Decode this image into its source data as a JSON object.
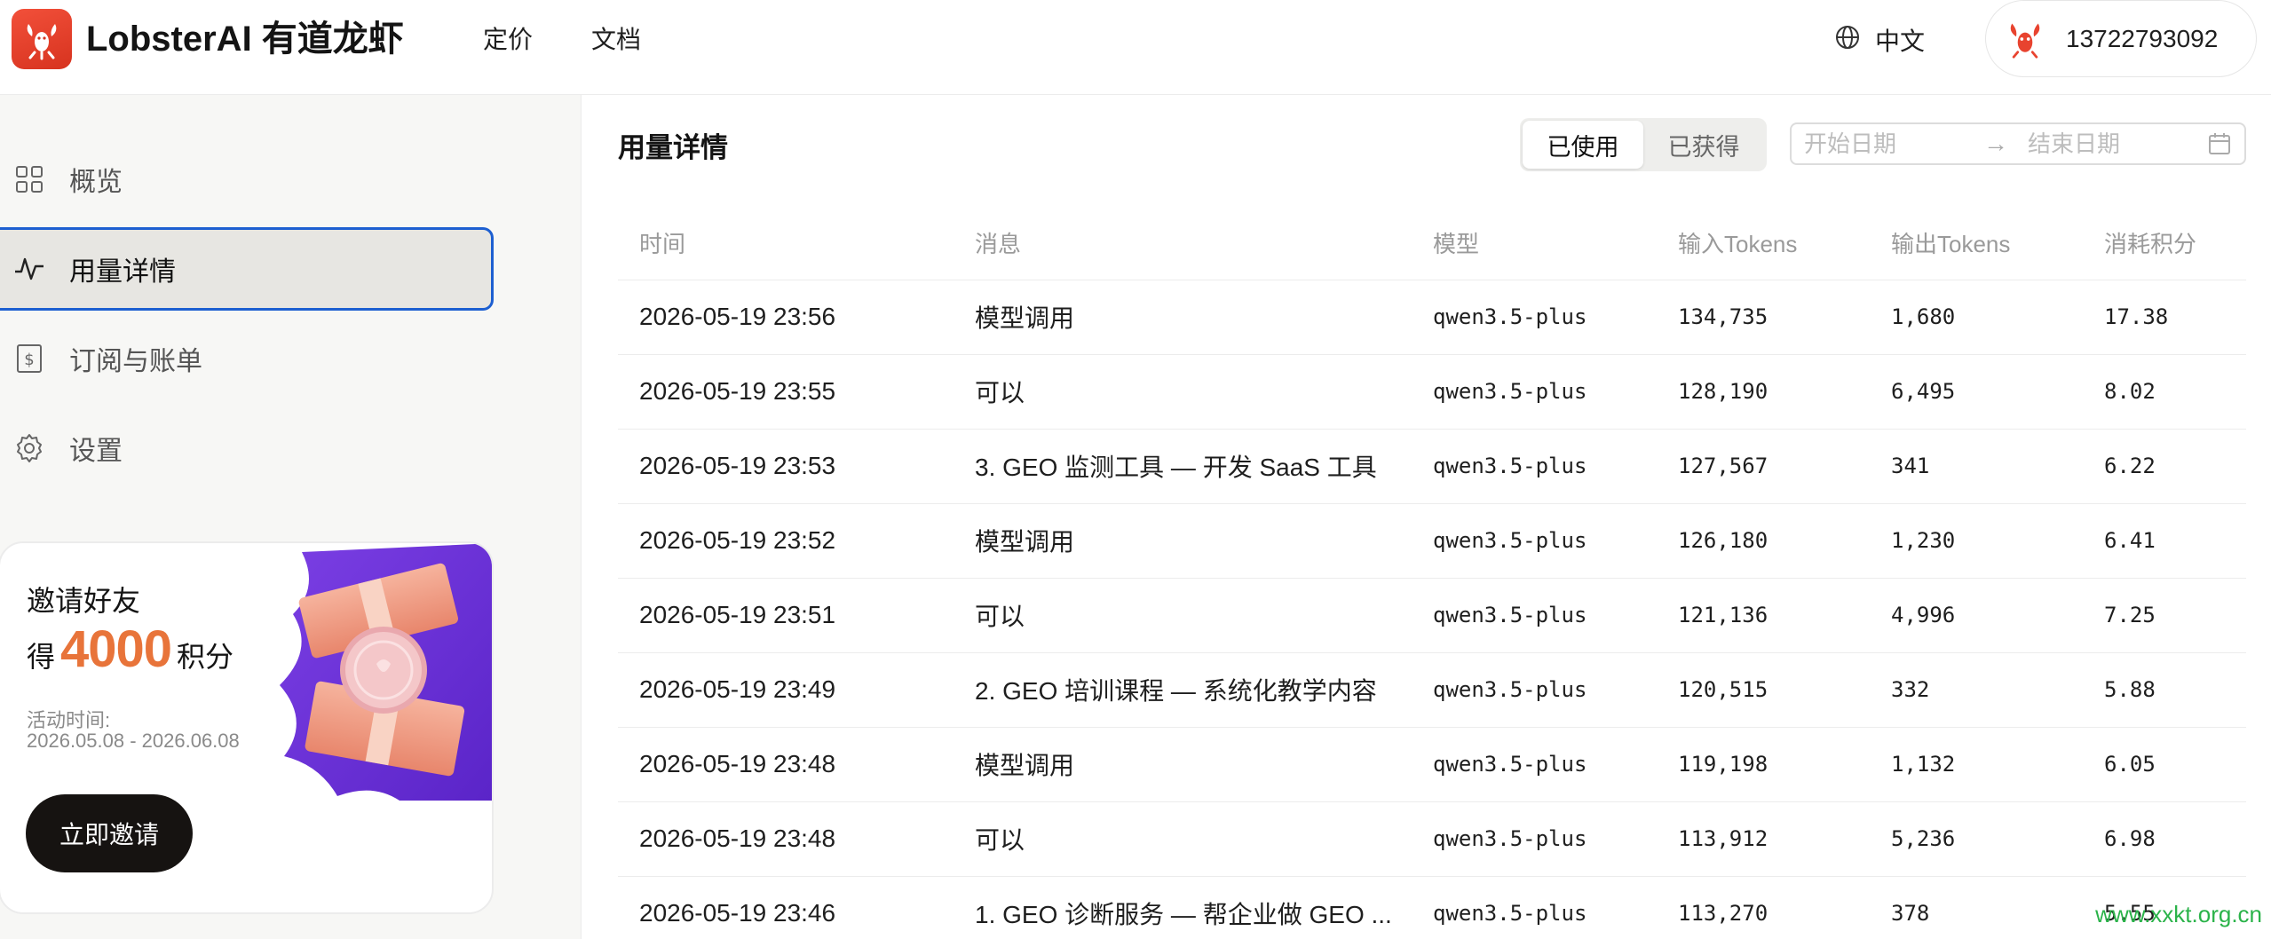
{
  "app": {
    "name": "LobsterAI 有道龙虾"
  },
  "nav": {
    "pricing": "定价",
    "docs": "文档"
  },
  "header": {
    "language": "中文",
    "user_phone": "13722793092"
  },
  "sidebar": {
    "items": [
      {
        "label": "概览",
        "icon": "grid-icon"
      },
      {
        "label": "用量详情",
        "icon": "activity-icon",
        "active": true
      },
      {
        "label": "订阅与账单",
        "icon": "billing-icon"
      },
      {
        "label": "设置",
        "icon": "gear-icon"
      }
    ]
  },
  "promo": {
    "title": "邀请好友",
    "prefix": "得",
    "points": "4000",
    "suffix": "积分",
    "period_label": "活动时间:",
    "period": "2026.05.08 - 2026.06.08",
    "button": "立即邀请"
  },
  "main": {
    "title": "用量详情",
    "tabs": [
      {
        "label": "已使用",
        "selected": true
      },
      {
        "label": "已获得",
        "selected": false
      }
    ],
    "date_range": {
      "start_placeholder": "开始日期",
      "end_placeholder": "结束日期"
    },
    "columns": [
      "时间",
      "消息",
      "模型",
      "输入Tokens",
      "输出Tokens",
      "消耗积分"
    ],
    "rows": [
      [
        "2026-05-19 23:56",
        "模型调用",
        "qwen3.5-plus",
        "134,735",
        "1,680",
        "17.38"
      ],
      [
        "2026-05-19 23:55",
        "可以",
        "qwen3.5-plus",
        "128,190",
        "6,495",
        "8.02"
      ],
      [
        "2026-05-19 23:53",
        "3. GEO 监测工具 — 开发 SaaS 工具",
        "qwen3.5-plus",
        "127,567",
        "341",
        "6.22"
      ],
      [
        "2026-05-19 23:52",
        "模型调用",
        "qwen3.5-plus",
        "126,180",
        "1,230",
        "6.41"
      ],
      [
        "2026-05-19 23:51",
        "可以",
        "qwen3.5-plus",
        "121,136",
        "4,996",
        "7.25"
      ],
      [
        "2026-05-19 23:49",
        "2. GEO 培训课程 — 系统化教学内容",
        "qwen3.5-plus",
        "120,515",
        "332",
        "5.88"
      ],
      [
        "2026-05-19 23:48",
        "模型调用",
        "qwen3.5-plus",
        "119,198",
        "1,132",
        "6.05"
      ],
      [
        "2026-05-19 23:48",
        "可以",
        "qwen3.5-plus",
        "113,912",
        "5,236",
        "6.98"
      ],
      [
        "2026-05-19 23:46",
        "1. GEO 诊断服务 — 帮企业做 GEO ...",
        "qwen3.5-plus",
        "113,270",
        "378",
        "5.55"
      ]
    ]
  },
  "watermark": "www.xxkt.org.cn",
  "colors": {
    "brand": "#e8432f",
    "accent": "#e8743a",
    "active_border": "#1d5fd1",
    "watermark": "#2bb34a"
  }
}
